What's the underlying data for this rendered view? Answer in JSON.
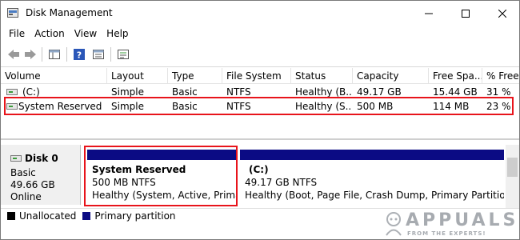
{
  "window": {
    "title": "Disk Management",
    "icon": "disk-management-icon",
    "controls": {
      "minimize": "minimize-icon",
      "maximize": "maximize-icon",
      "close": "close-icon"
    }
  },
  "menu": [
    "File",
    "Action",
    "View",
    "Help"
  ],
  "toolbar": {
    "icons": [
      "back-arrow-icon",
      "forward-arrow-icon",
      "console-tree-icon",
      "help-icon",
      "properties-icon",
      "export-list-icon"
    ]
  },
  "volumes": {
    "columns": [
      "Volume",
      "Layout",
      "Type",
      "File System",
      "Status",
      "Capacity",
      "Free Spa...",
      "% Free"
    ],
    "rows": [
      {
        "volume": "(C:)",
        "layout": "Simple",
        "type": "Basic",
        "fs": "NTFS",
        "status": "Healthy (B...",
        "capacity": "49.17 GB",
        "free": "15.44 GB",
        "pct": "31 %"
      },
      {
        "volume": "System Reserved",
        "layout": "Simple",
        "type": "Basic",
        "fs": "NTFS",
        "status": "Healthy (S...",
        "capacity": "500 MB",
        "free": "114 MB",
        "pct": "23 %"
      }
    ]
  },
  "disk": {
    "name": "Disk 0",
    "type": "Basic",
    "size": "49.66 GB",
    "status": "Online",
    "partitions": [
      {
        "title": "System Reserved",
        "size": "500 MB NTFS",
        "status": "Healthy (System, Active, Primary"
      },
      {
        "title": "(C:)",
        "size": "49.17 GB NTFS",
        "status": "Healthy (Boot, Page File, Crash Dump, Primary Partition)"
      }
    ]
  },
  "legend": [
    {
      "label": "Unallocated",
      "color": "#000000"
    },
    {
      "label": "Primary partition",
      "color": "#0b0b84"
    }
  ],
  "colors": {
    "highlight": "#e8141b",
    "partition_bar": "#0b0b84"
  },
  "watermark": {
    "text": "APPUALS",
    "sub": "FROM THE EXPERTS!"
  }
}
